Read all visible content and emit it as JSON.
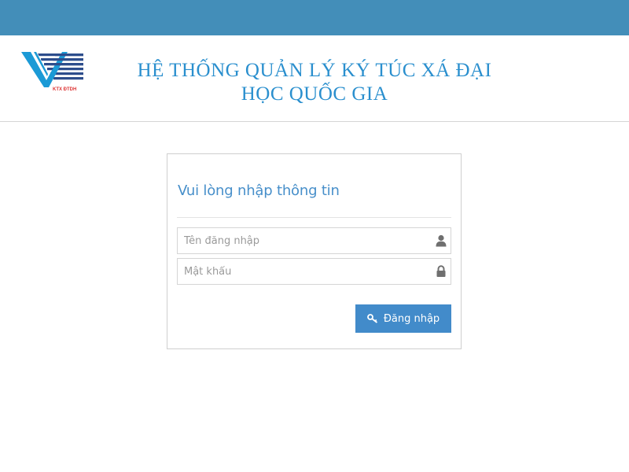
{
  "header": {
    "title_line1": "HỆ THỐNG QUẢN LÝ KÝ TÚC XÁ ĐẠI",
    "title_line2": "HỌC QUỐC GIA",
    "logo_text": "KTX ĐTDH"
  },
  "login": {
    "heading": "Vui lòng nhập thông tin",
    "username_placeholder": "Tên đăng nhập",
    "password_placeholder": "Mật khẩu",
    "submit_label": "Đăng nhập",
    "username_icon": "user-icon",
    "password_icon": "lock-icon",
    "submit_icon": "key-icon"
  },
  "colors": {
    "topbar": "#438eb9",
    "title": "#2a8fce",
    "heading": "#478fca",
    "button": "#428bca"
  }
}
